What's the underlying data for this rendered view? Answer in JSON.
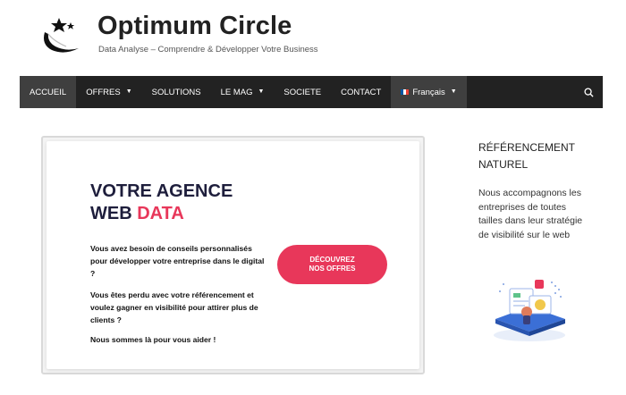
{
  "site": {
    "title": "Optimum Circle",
    "tagline": "Data Analyse – Comprendre & Développer Votre Business"
  },
  "nav": {
    "items": [
      {
        "label": "ACCUEIL"
      },
      {
        "label": "OFFRES"
      },
      {
        "label": "SOLUTIONS"
      },
      {
        "label": "LE MAG"
      },
      {
        "label": "SOCIETE"
      },
      {
        "label": "CONTACT"
      }
    ],
    "language": "Français"
  },
  "hero": {
    "title_line1": "VOTRE AGENCE",
    "title_line2_prefix": "WEB ",
    "title_line2_accent": "DATA",
    "p1": "Vous avez besoin de conseils personnalisés pour développer votre entreprise dans le digital ?",
    "p2": "Vous êtes perdu avec votre référencement et voulez gagner en visibilité pour attirer plus de clients ?",
    "p3": "Nous sommes là pour vous aider !",
    "cta": "DÉCOUVREZ\nNOS OFFRES"
  },
  "sidebar": {
    "title": "RÉFÉRENCEMENT NATUREL",
    "text": "Nous accompagnons les entreprises de toutes tailles dans leur stratégie de visibilité sur le web"
  },
  "colors": {
    "nav_bg": "#222222",
    "accent": "#e8375a",
    "heading": "#1e1e3c"
  }
}
